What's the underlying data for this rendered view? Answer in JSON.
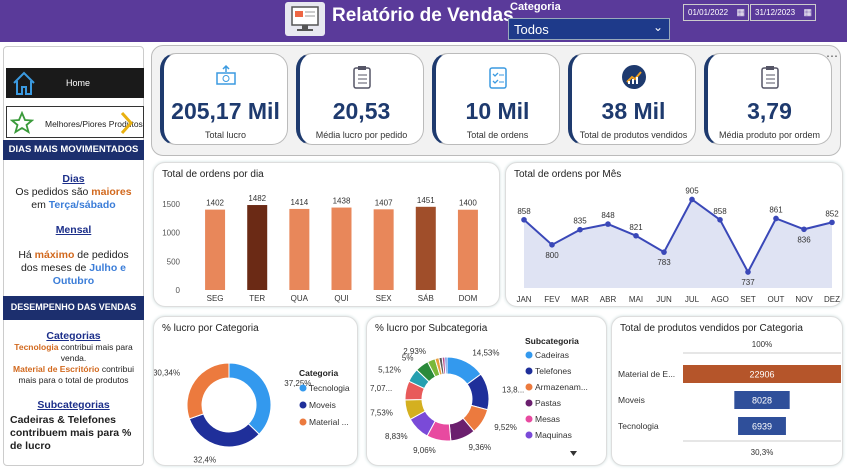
{
  "header": {
    "title": "Relatório de Vendas",
    "category_label": "Categoria",
    "category_value": "Todos",
    "date_start": "01/01/2022",
    "date_end": "31/12/2023"
  },
  "sidebar": {
    "home": "Home",
    "best_worst": "Melhores/Piores Produtos",
    "sec1": "DIAS MAIS MOVIMENTADOS",
    "dias_title": "Dias",
    "dias_l1a": "Os pedidos são ",
    "dias_l1b": "maiores",
    "dias_l2a": "em ",
    "dias_l2b": "Terça/sábado",
    ".": ".",
    "mensal_title": "Mensal",
    "mensal_l1a": "Há ",
    "mensal_l1b": "máximo",
    "mensal_l1c": " de pedidos",
    "mensal_l2": "dos meses de ",
    "mensal_l2b": "Julho e",
    "mensal_l3": "Outubro",
    "sec2": "DESEMPENHO DAS VENDAS",
    "cat_title": "Categorias",
    "cat_l1a": "Tecnologia",
    "cat_l1b": " contribui mais para",
    "cat_l2": "venda.",
    "cat_l3a": "Material de Escritório",
    "cat_l3b": " contribui",
    "cat_l4": "mais para o total de produtos",
    "sub_title": "Subcategorias",
    "sub_l1": "Cadeiras & Telefones",
    "sub_l2": "contribuem mais para %",
    "sub_l3": "de lucro"
  },
  "kpis": [
    {
      "value": "205,17 Mil",
      "label": "Total lucro",
      "icon": "money-icon"
    },
    {
      "value": "20,53",
      "label": "Média lucro por pedido",
      "icon": "clipboard-icon"
    },
    {
      "value": "10 Mil",
      "label": "Total de ordens",
      "icon": "checklist-icon"
    },
    {
      "value": "38 Mil",
      "label": "Total de produtos vendidos",
      "icon": "growth-chart-icon"
    },
    {
      "value": "3,79",
      "label": "Média produto por ordem",
      "icon": "clipboard-icon"
    }
  ],
  "chart_data": [
    {
      "type": "bar",
      "title": "Total de ordens por dia",
      "categories": [
        "SEG",
        "TER",
        "QUA",
        "QUI",
        "SEX",
        "SÁB",
        "DOM"
      ],
      "values": [
        1402,
        1482,
        1414,
        1438,
        1407,
        1451,
        1400
      ],
      "yticks": [
        0,
        500,
        1000,
        1500
      ],
      "ylim": [
        0,
        1500
      ],
      "colors": [
        "#e8875a",
        "#6b2a15",
        "#e8875a",
        "#e8875a",
        "#e8875a",
        "#a04e2a",
        "#e8875a"
      ]
    },
    {
      "type": "area",
      "title": "Total de ordens por Mês",
      "categories": [
        "JAN",
        "FEV",
        "MAR",
        "ABR",
        "MAI",
        "JUN",
        "JUL",
        "AGO",
        "SET",
        "OUT",
        "NOV",
        "DEZ"
      ],
      "values": [
        858,
        800,
        835,
        848,
        821,
        783,
        905,
        858,
        737,
        861,
        836,
        852
      ]
    },
    {
      "type": "pie",
      "title": "% lucro por Categoria",
      "legend_title": "Categoria",
      "labels": [
        "Tecnologia",
        "Moveis",
        "Material ..."
      ],
      "values": [
        37.25,
        32.4,
        30.34
      ],
      "value_labels": [
        "37,25%",
        "32,4%",
        "30,34%"
      ],
      "colors": [
        "#3399ee",
        "#1f2f9a",
        "#ec7a3e"
      ]
    },
    {
      "type": "pie",
      "title": "% lucro por Subcategoria",
      "legend_title": "Subcategoria",
      "legend": [
        "Cadeiras",
        "Telefones",
        "Armazenam...",
        "Pastas",
        "Mesas",
        "Maquinas"
      ],
      "values": [
        14.53,
        13.8,
        9.52,
        9.36,
        9.06,
        8.83,
        7.53,
        7.07,
        5.12,
        5,
        2.93,
        1.5,
        1.2,
        1.0,
        0.8
      ],
      "value_labels": [
        "14,53%",
        "13,8...",
        "9,52%",
        "9,36%",
        "9,06%",
        "8,83%",
        "7,53%",
        "7,07...",
        "5,12%",
        "5%",
        "2,93%",
        "",
        "",
        "",
        ""
      ],
      "colors": [
        "#3399ee",
        "#1f2f9a",
        "#ec7a3e",
        "#6b1f6e",
        "#e84aa0",
        "#7a4ad8",
        "#d4b020",
        "#e85a5a",
        "#26a0b0",
        "#2a8a3a",
        "#7ab83a",
        "#e8a040",
        "#5a5a5a",
        "#b84a8a",
        "#3a6ad8"
      ]
    },
    {
      "type": "bar",
      "title": "Total de produtos vendidos por Categoria",
      "categories": [
        "Material de E...",
        "Moveis",
        "Tecnologia"
      ],
      "values": [
        22906,
        8028,
        6939
      ],
      "value_labels": [
        "22906",
        "8028",
        "6939"
      ],
      "top_pct": "100%",
      "bottom_pct": "30,3%",
      "colors": [
        "#b5552a",
        "#2f4f9a",
        "#2f4f9a"
      ]
    }
  ]
}
